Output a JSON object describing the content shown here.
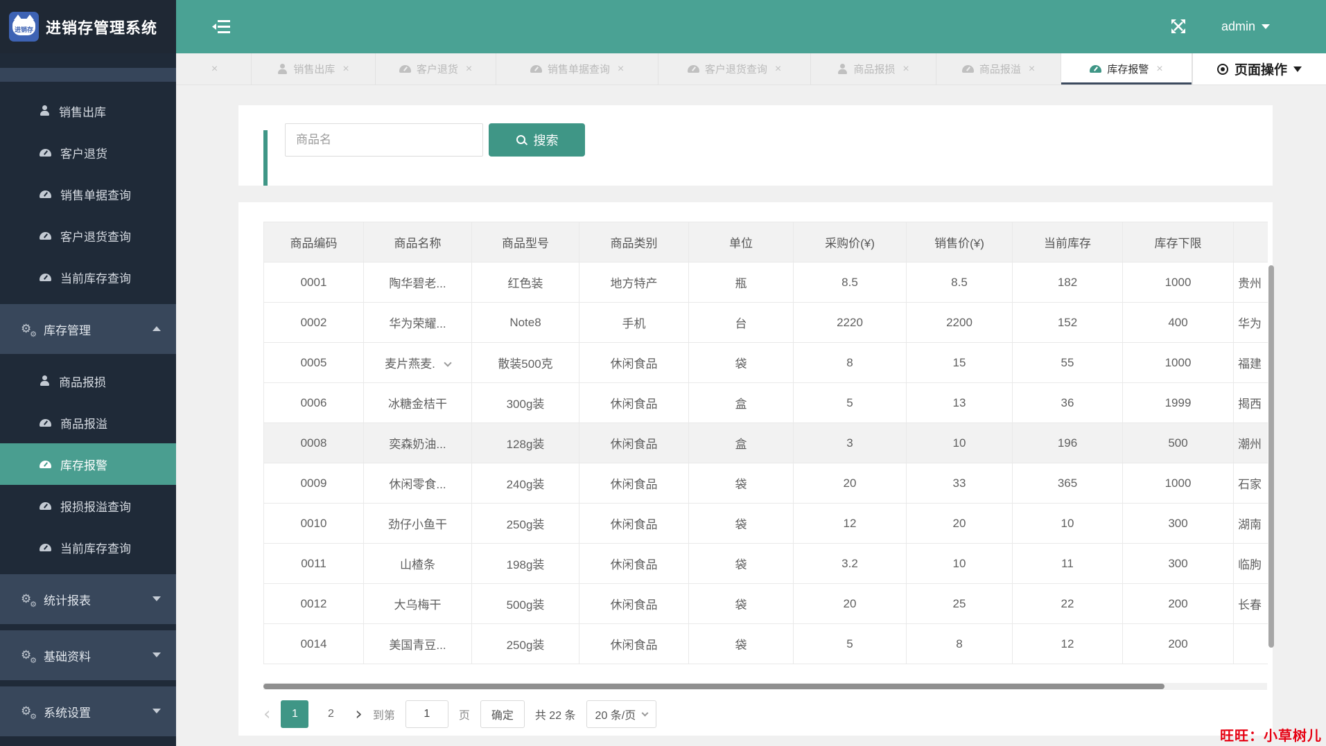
{
  "app": {
    "title": "进销存管理系统",
    "logo_text": "进销存"
  },
  "header": {
    "username": "admin"
  },
  "sidebar": {
    "items": [
      {
        "type": "child",
        "icon": "user",
        "label": "销售出库"
      },
      {
        "type": "child",
        "icon": "dashboard",
        "label": "客户退货"
      },
      {
        "type": "child",
        "icon": "dashboard",
        "label": "销售单据查询"
      },
      {
        "type": "child",
        "icon": "dashboard",
        "label": "客户退货查询"
      },
      {
        "type": "child",
        "icon": "dashboard",
        "label": "当前库存查询"
      },
      {
        "type": "parent",
        "icon": "cogs",
        "label": "库存管理",
        "caret": "up"
      },
      {
        "type": "child",
        "icon": "user",
        "label": "商品报损"
      },
      {
        "type": "child",
        "icon": "dashboard",
        "label": "商品报溢"
      },
      {
        "type": "child",
        "icon": "dashboard",
        "label": "库存报警",
        "active": true
      },
      {
        "type": "child",
        "icon": "dashboard",
        "label": "报损报溢查询"
      },
      {
        "type": "child",
        "icon": "dashboard",
        "label": "当前库存查询"
      },
      {
        "type": "parent",
        "icon": "cogs",
        "label": "统计报表",
        "caret": "down"
      },
      {
        "type": "parent",
        "icon": "cogs",
        "label": "基础资料",
        "caret": "down"
      },
      {
        "type": "parent",
        "icon": "cogs",
        "label": "系统设置",
        "caret": "down"
      }
    ]
  },
  "tabs": {
    "items": [
      {
        "label": "",
        "icon": "",
        "closable": true
      },
      {
        "label": "销售出库",
        "icon": "user",
        "closable": true
      },
      {
        "label": "客户退货",
        "icon": "dashboard",
        "closable": true
      },
      {
        "label": "销售单据查询",
        "icon": "dashboard",
        "closable": true
      },
      {
        "label": "客户退货查询",
        "icon": "dashboard",
        "closable": true
      },
      {
        "label": "商品报损",
        "icon": "user",
        "closable": true
      },
      {
        "label": "商品报溢",
        "icon": "dashboard",
        "closable": true
      },
      {
        "label": "库存报警",
        "icon": "dashboard",
        "closable": true,
        "active": true
      }
    ],
    "page_ops": "页面操作"
  },
  "search": {
    "placeholder": "商品名",
    "button": "搜索"
  },
  "table": {
    "columns": [
      "商品编码",
      "商品名称",
      "商品型号",
      "商品类别",
      "单位",
      "采购价(¥)",
      "销售价(¥)",
      "当前库存",
      "库存下限",
      ""
    ],
    "rows": [
      [
        "0001",
        "陶华碧老...",
        "红色装",
        "地方特产",
        "瓶",
        "8.5",
        "8.5",
        "182",
        "1000",
        "贵州"
      ],
      [
        "0002",
        "华为荣耀...",
        "Note8",
        "手机",
        "台",
        "2220",
        "2200",
        "152",
        "400",
        "华为"
      ],
      [
        "0005",
        "麦片燕麦.",
        "散装500克",
        "休闲食品",
        "袋",
        "8",
        "15",
        "55",
        "1000",
        "福建"
      ],
      [
        "0006",
        "冰糖金桔干",
        "300g装",
        "休闲食品",
        "盒",
        "5",
        "13",
        "36",
        "1999",
        "揭西"
      ],
      [
        "0008",
        "奕森奶油...",
        "128g装",
        "休闲食品",
        "盒",
        "3",
        "10",
        "196",
        "500",
        "潮州"
      ],
      [
        "0009",
        "休闲零食...",
        "240g装",
        "休闲食品",
        "袋",
        "20",
        "33",
        "365",
        "1000",
        "石家"
      ],
      [
        "0010",
        "劲仔小鱼干",
        "250g装",
        "休闲食品",
        "袋",
        "12",
        "20",
        "10",
        "300",
        "湖南"
      ],
      [
        "0011",
        "山楂条",
        "198g装",
        "休闲食品",
        "袋",
        "3.2",
        "10",
        "11",
        "300",
        "临朐"
      ],
      [
        "0012",
        "大乌梅干",
        "500g装",
        "休闲食品",
        "袋",
        "20",
        "25",
        "22",
        "200",
        "长春"
      ],
      [
        "0014",
        "美国青豆...",
        "250g装",
        "休闲食品",
        "袋",
        "5",
        "8",
        "12",
        "200",
        ""
      ]
    ],
    "hover_row_index": 4,
    "name_caret_row_index": 2
  },
  "pagination": {
    "prev": "‹",
    "pages": [
      "1",
      "2"
    ],
    "active_page": "1",
    "next": "›",
    "goto_label": "到第",
    "goto_value": "1",
    "page_unit": "页",
    "confirm": "确定",
    "total": "共 22 条",
    "page_size": "20 条/页"
  },
  "watermark": "旺旺：小草树儿",
  "colors": {
    "header_teal": "#4aa294",
    "button_teal": "#3f9686",
    "sidebar_dark": "#1f2a38",
    "sidebar_light": "#38475b",
    "active_item_teal": "#4a9e90",
    "active_tab_underline": "#3c4a5e",
    "watermark_red": "#e60012"
  }
}
